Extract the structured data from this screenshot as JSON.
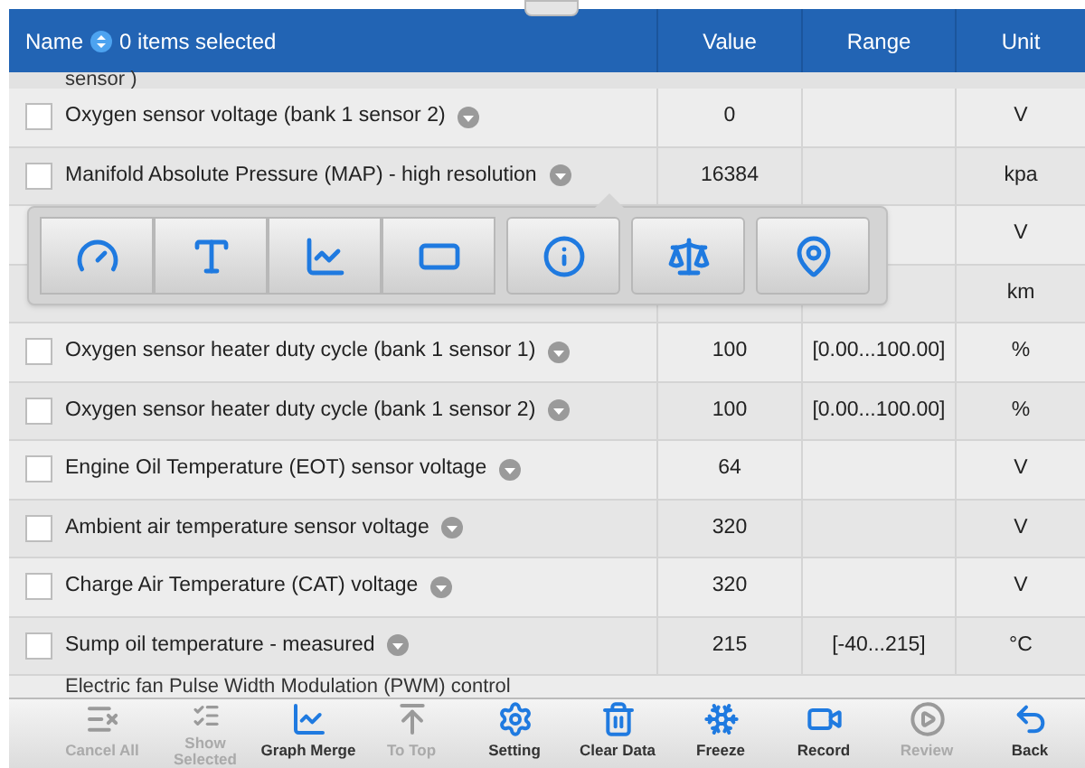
{
  "header": {
    "name": "Name",
    "selection": "0 items selected",
    "columns": [
      "Value",
      "Range",
      "Unit"
    ]
  },
  "top_partial_row": {
    "name": "sensor )"
  },
  "rows": [
    {
      "name": "Oxygen sensor voltage (bank 1 sensor 2)",
      "value": "0",
      "range": "",
      "unit": "V",
      "checked": false
    },
    {
      "name": "Manifold Absolute Pressure (MAP) - high resolution",
      "value": "16384",
      "range": "",
      "unit": "kpa",
      "checked": false
    },
    {
      "name": "",
      "value": "",
      "range": "",
      "unit": "V"
    },
    {
      "name": "",
      "value": "",
      "range": "",
      "unit": "km"
    },
    {
      "name": "Oxygen sensor heater duty cycle (bank 1 sensor 1)",
      "value": "100",
      "range": "[0.00...100.00]",
      "unit": "%",
      "checked": false
    },
    {
      "name": "Oxygen sensor heater duty cycle (bank 1 sensor 2)",
      "value": "100",
      "range": "[0.00...100.00]",
      "unit": "%",
      "checked": false
    },
    {
      "name": "Engine Oil Temperature (EOT) sensor voltage",
      "value": "64",
      "range": "",
      "unit": "V",
      "checked": false
    },
    {
      "name": "Ambient air temperature sensor voltage",
      "value": "320",
      "range": "",
      "unit": "V",
      "checked": false
    },
    {
      "name": "Charge Air Temperature (CAT) voltage",
      "value": "320",
      "range": "",
      "unit": "V",
      "checked": false
    },
    {
      "name": "Sump oil temperature - measured",
      "value": "215",
      "range": "[-40...215]",
      "unit": "°C",
      "checked": false
    }
  ],
  "bottom_partial_row": {
    "name": "Electric fan Pulse Width Modulation (PWM) control"
  },
  "toolbar": [
    {
      "kind": "cancel",
      "label": "Cancel All",
      "disabled": true
    },
    {
      "kind": "show",
      "label": "Show Selected",
      "disabled": true
    },
    {
      "kind": "graph",
      "label": "Graph Merge",
      "disabled": false
    },
    {
      "kind": "top",
      "label": "To Top",
      "disabled": true
    },
    {
      "kind": "setting",
      "label": "Setting",
      "disabled": false
    },
    {
      "kind": "clear",
      "label": "Clear Data",
      "disabled": false
    },
    {
      "kind": "freeze",
      "label": "Freeze",
      "disabled": false
    },
    {
      "kind": "record",
      "label": "Record",
      "disabled": false
    },
    {
      "kind": "review",
      "label": "Review",
      "disabled": true
    },
    {
      "kind": "back",
      "label": "Back",
      "disabled": false
    }
  ]
}
